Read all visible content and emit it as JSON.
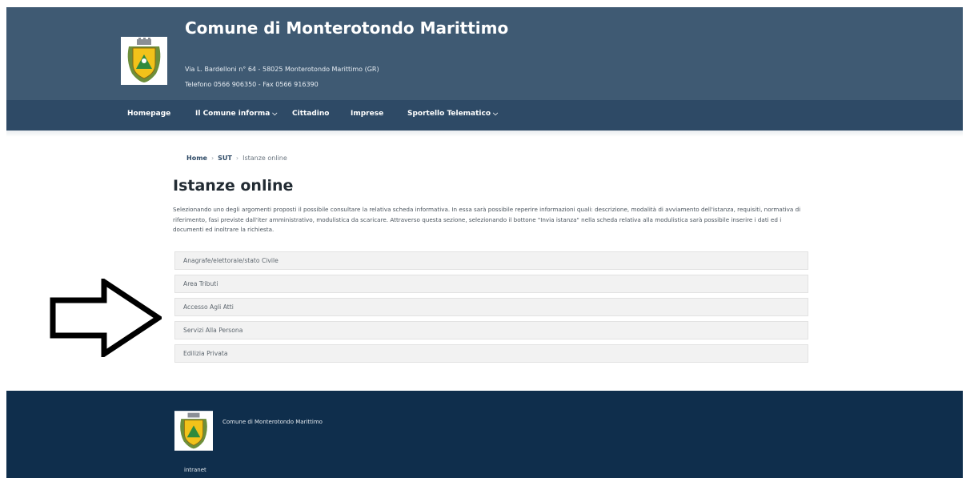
{
  "header": {
    "title": "Comune di Monterotondo Marittimo",
    "address": "Via L. Bardelloni n° 64 - 58025 Monterotondo Marittimo (GR)",
    "phone": "Telefono 0566 906350 - Fax 0566 916390"
  },
  "nav": {
    "items": [
      {
        "label": "Homepage"
      },
      {
        "label": "Il Comune informa"
      },
      {
        "label": "Cittadino"
      },
      {
        "label": "Imprese"
      },
      {
        "label": "Sportello Telematico"
      }
    ]
  },
  "breadcrumb": {
    "home": "Home",
    "sut": "SUT",
    "current": "Istanze online",
    "separator": "›"
  },
  "main": {
    "title": "Istanze online",
    "intro": "Selezionando uno degli argomenti proposti il possibile consultare la relativa scheda informativa. In essa sarà possibile reperire informazioni quali: descrizione, modalità di avviamento dell'istanza, requisiti, normativa di riferimento, fasi previste dall'iter amministrativo, modulistica da scaricare. Attraverso questa sezione, selezionando il bottone \"Invia istanza\" nella scheda relativa alla modulistica sarà possibile inserire i dati ed i documenti ed inoltrare la richiesta.",
    "topics": [
      "Anagrafe/elettorale/stato Civile",
      "Area Tributi",
      "Accesso Agli Atti",
      "Servizi Alla Persona",
      "Edilizia Privata"
    ]
  },
  "footer": {
    "name": "Comune di Monterotondo Marittimo",
    "intranet": "intranet"
  },
  "colors": {
    "header": "#3f5a73",
    "nav": "#2e4a66",
    "footer": "#0f2e4c",
    "topic_bg": "#f2f2f2"
  },
  "icons": {
    "logo": "coat-of-arms-icon",
    "dropdown": "chevron-down-icon",
    "annotation": "arrow-right-icon"
  }
}
